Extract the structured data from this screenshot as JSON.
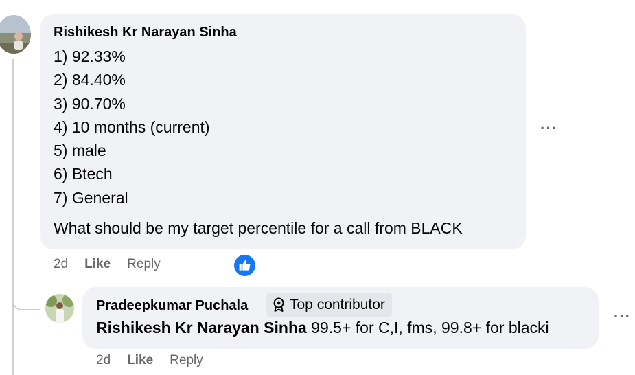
{
  "comment": {
    "author": "Rishikesh Kr Narayan Sinha",
    "lines": [
      "1) 92.33%",
      "2) 84.40%",
      "3) 90.70%",
      "4) 10 months (current)",
      "5) male",
      "6) Btech",
      "7) General"
    ],
    "question": "What should be my target percentile for a call from BLACK",
    "time": "2d",
    "like_label": "Like",
    "reply_label": "Reply",
    "reaction": "like-reaction-icon",
    "more_label": "···"
  },
  "reply": {
    "author": "Pradeepkumar Puchala",
    "badge": "Top contributor",
    "mention": "Rishikesh Kr Narayan Sinha",
    "text": " 99.5+ for C,I, fms, 99.8+ for blacki",
    "time": "2d",
    "like_label": "Like",
    "reply_label": "Reply",
    "more_label": "···"
  },
  "colors": {
    "bubble": "#f0f2f5",
    "badge": "#e4e6eb",
    "secondary_text": "#65676b",
    "like_blue": "#1877f2"
  }
}
